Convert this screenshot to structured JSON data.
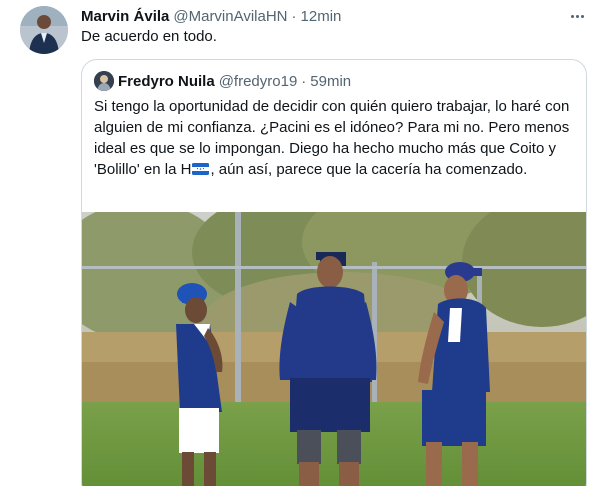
{
  "tweet": {
    "author_name": "Marvin Ávila",
    "author_handle": "@MarvinAvilaHN",
    "separator": "·",
    "time": "12min",
    "text": "De acuerdo en todo.",
    "more_icon": "more-horizontal-icon"
  },
  "quote": {
    "author_name": "Fredyro Nuila",
    "author_handle": "@fredyro19",
    "separator": "·",
    "time": "59min",
    "text_part1": "Si tengo la oportunidad de decidir con quién quiero trabajar, lo haré con alguien de mi confianza. ¿Pacini es el idóneo? Para mi no. Pero menos ideal es que se lo impongan. Diego ha hecho mucho más que Coito y 'Bolillo' en la H",
    "text_part2": ", aún así, parece que la cacería ha comenzado.",
    "flag_icon": "honduras-flag-icon"
  },
  "colors": {
    "primary_text": "#0f1419",
    "secondary_text": "#536471",
    "border": "#cfd9de",
    "kit_blue": "#1f3b8c",
    "grass": "#6c9a3c"
  }
}
